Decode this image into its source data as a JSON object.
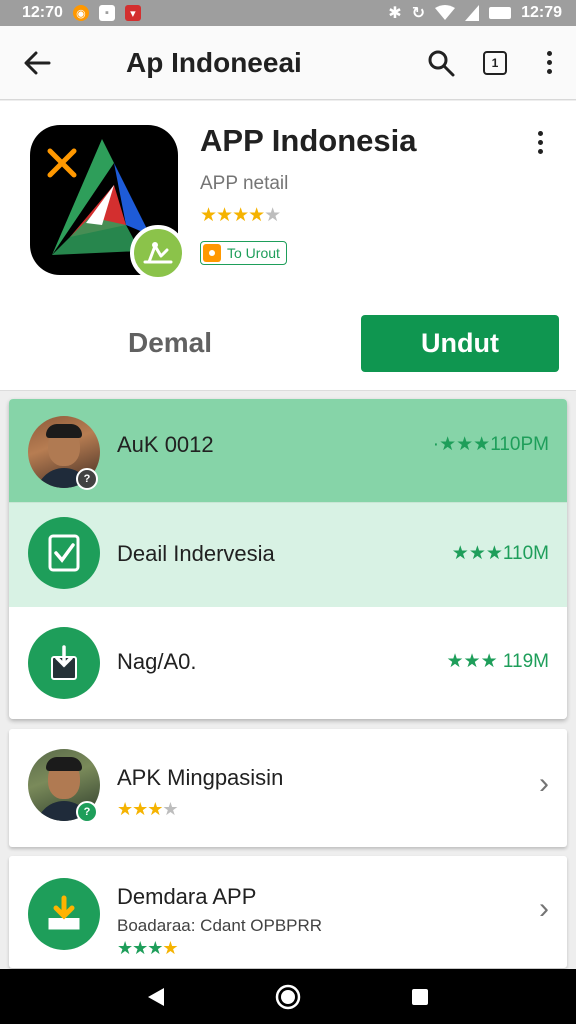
{
  "status_bar": {
    "time_left": "12:70",
    "time_right": "12:79",
    "icons": [
      "app-orange-icon",
      "app-white-icon",
      "app-red-icon",
      "bluetooth-icon",
      "sync-icon",
      "wifi-icon",
      "battery-icon"
    ]
  },
  "app_bar": {
    "title": "Ap Indoneeai",
    "tab_count": "1",
    "icons": [
      "back-arrow-icon",
      "search-icon",
      "tabs-icon",
      "more-vert-icon"
    ]
  },
  "header": {
    "app_name": "APP Indonesia",
    "subtitle": "APP netail",
    "rating": 4.5,
    "tag_label": "To Urout",
    "secondary_button": "Demal",
    "primary_button": "Undut",
    "accent_color": "#0f9650"
  },
  "ranked_list": [
    {
      "name": "AuK 0012",
      "meta": "·★★★110PM",
      "highlight": "#86d4a8"
    },
    {
      "name": "Deail Indervesia",
      "meta": "★★★110M",
      "highlight": "#d8f2e4"
    },
    {
      "name": "Nag/A0.",
      "meta": "★★★ 119M",
      "highlight": "#ffffff"
    }
  ],
  "suggestions": [
    {
      "title": "APK Mingpasisin",
      "subtitle": "",
      "rating": 3.5
    },
    {
      "title": "Demdara APP",
      "subtitle": "Boadaraa:  Cdant OPBPRR",
      "rating": 4
    }
  ],
  "nav_bar": {
    "icons": [
      "back-triangle-icon",
      "home-circle-icon",
      "recents-square-icon"
    ]
  }
}
